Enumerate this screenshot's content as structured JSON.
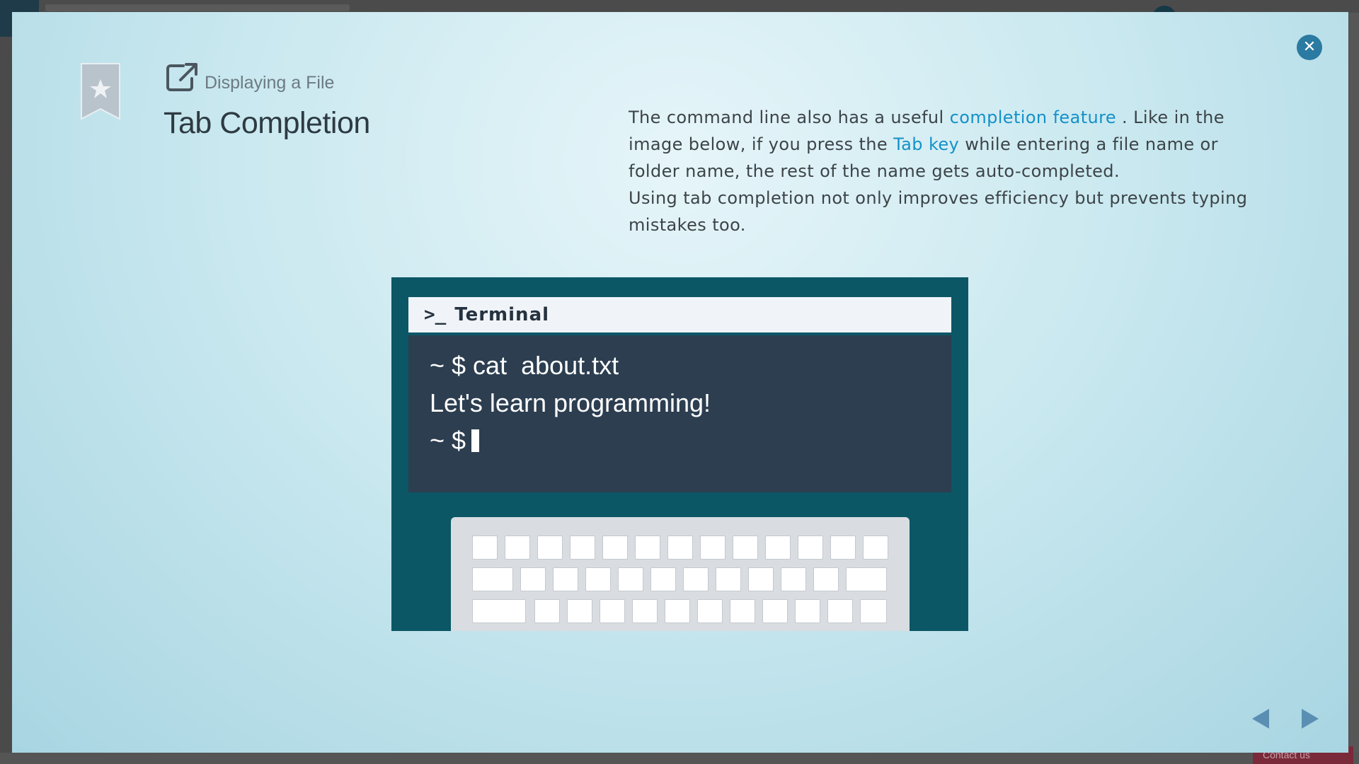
{
  "modal": {
    "subtitle": "Displaying a File",
    "title": "Tab Completion",
    "close_icon": "close-icon",
    "bookmark_icon": "bookmark-star-icon",
    "external_icon": "external-link-icon"
  },
  "description": {
    "p1_before": "The command line also has a useful ",
    "link1": "completion feature",
    "p1_mid": " . Like in the image below, if you press the ",
    "link2": "Tab key",
    "p1_after": " while entering a file name or folder name, the rest of the name gets auto-completed.",
    "p2": "Using tab completion not only improves efficiency but prevents typing mistakes too."
  },
  "terminal": {
    "prompt_icon": ">_",
    "title": "Terminal",
    "lines": [
      "~ $ cat  about.txt",
      "Let's learn programming!",
      "~ $"
    ]
  },
  "navigation": {
    "prev_icon": "arrow-left-icon",
    "next_icon": "arrow-right-icon"
  },
  "background": {
    "contact_label": "Contact us"
  },
  "colors": {
    "accent": "#1591c8",
    "close": "#2a7aa2",
    "illustration_bg": "#0c5766",
    "terminal_bg": "#2c3e50",
    "nav_arrow": "#5a8fb3"
  }
}
